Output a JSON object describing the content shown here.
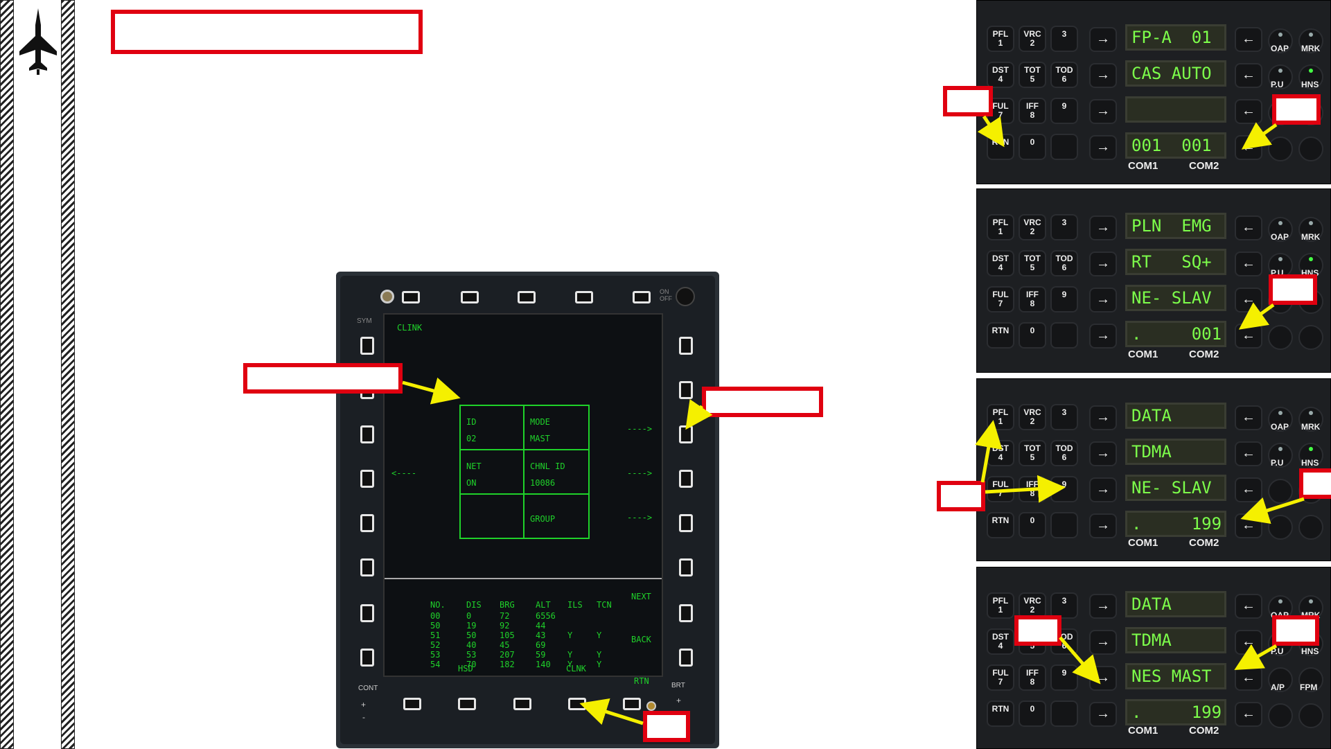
{
  "mfd": {
    "title": "CLINK",
    "labels": {
      "sym": "SYM",
      "onoff": "ON\nOFF",
      "cont": "CONT",
      "brt": "BRT",
      "plus": "+",
      "minus": "-"
    },
    "grid": {
      "id_label": "ID",
      "id_value": "02",
      "mode_label": "MODE",
      "mode_value": "MAST",
      "net_label": "NET",
      "net_value": "ON",
      "chnl_label": "CHNL ID",
      "chnl_value": "10086",
      "group_label": "GROUP"
    },
    "arrows": {
      "left": "<----",
      "right1": "---->",
      "right2": "---->",
      "right3": "---->"
    },
    "side": {
      "next": "NEXT",
      "back": "BACK",
      "rtn": "RTN"
    },
    "bottom": {
      "hsd": "HSD",
      "clnk": "CLNK"
    },
    "table": {
      "headers": [
        "NO.",
        "DIS",
        "BRG",
        "ALT",
        "ILS",
        "TCN"
      ],
      "rows": [
        [
          "00",
          "0",
          "72",
          "6556",
          "",
          ""
        ],
        [
          "50",
          "19",
          "92",
          "44",
          "",
          ""
        ],
        [
          "51",
          "50",
          "105",
          "43",
          "Y",
          "Y"
        ],
        [
          "52",
          "40",
          "45",
          "69",
          "",
          ""
        ],
        [
          "53",
          "53",
          "207",
          "59",
          "Y",
          "Y"
        ],
        [
          "54",
          "70",
          "182",
          "140",
          "Y",
          "Y"
        ]
      ]
    }
  },
  "ufc_keys": {
    "k1": "PFL\n1",
    "k2": "VRC\n2",
    "k3": "3",
    "k4": "DST\n4",
    "k5": "TOT\n5",
    "k6": "TOD\n6",
    "k7": "FUL\n7",
    "k8": "IFF\n8",
    "k9": "9",
    "kr": "RTN",
    "k0": "0",
    "oap": "OAP",
    "mrk": "MRK",
    "pu": "P.U",
    "hns": "HNS",
    "ap": "A/P",
    "fpm": "FPM",
    "com1": "COM1",
    "com2": "COM2"
  },
  "ufc_panels": [
    {
      "lines": [
        "FP-A  01",
        "CAS AUTO",
        "",
        "001  001"
      ]
    },
    {
      "lines": [
        "PLN  EMG",
        "RT   SQ+",
        "NE- SLAV",
        ".     001"
      ]
    },
    {
      "lines": [
        "DATA",
        "TDMA",
        "NE- SLAV",
        ".     199"
      ]
    },
    {
      "lines": [
        "DATA",
        "TDMA",
        "NES MAST",
        ".     199"
      ]
    }
  ],
  "colors": {
    "callout": "#e00010",
    "arrow": "#f5f000",
    "phosphor": "#1fd22a",
    "ufc_text": "#7dff4b"
  }
}
